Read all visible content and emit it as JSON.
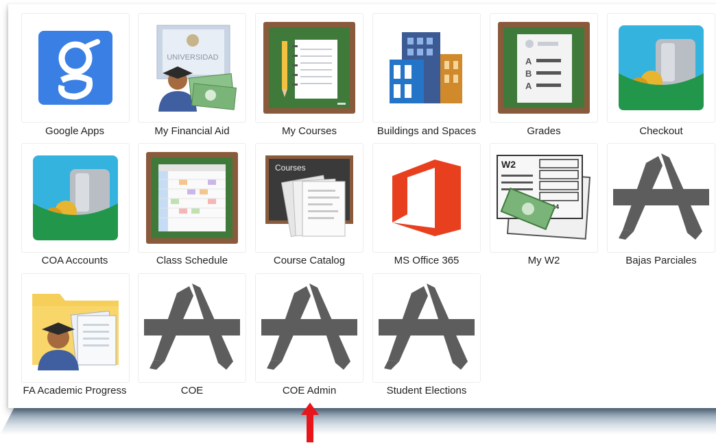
{
  "apps": [
    {
      "label": "Google Apps",
      "icon": "google-g-icon"
    },
    {
      "label": "My Financial Aid",
      "icon": "graduate-money-icon"
    },
    {
      "label": "My Courses",
      "icon": "notebook-chalkboard-icon"
    },
    {
      "label": "Buildings and Spaces",
      "icon": "buildings-icon"
    },
    {
      "label": "Grades",
      "icon": "grades-sheet-icon"
    },
    {
      "label": "Checkout",
      "icon": "wallet-coins-icon"
    },
    {
      "label": "COA Accounts",
      "icon": "wallet-coins-icon"
    },
    {
      "label": "Class Schedule",
      "icon": "schedule-grid-icon"
    },
    {
      "label": "Course Catalog",
      "icon": "course-catalog-icon"
    },
    {
      "label": "MS Office 365",
      "icon": "office-icon"
    },
    {
      "label": "My W2",
      "icon": "w2-form-icon"
    },
    {
      "label": "Bajas Parciales",
      "icon": "app-store-icon"
    },
    {
      "label": "FA Academic Progress",
      "icon": "folder-graduate-icon"
    },
    {
      "label": "COE",
      "icon": "app-store-icon"
    },
    {
      "label": "COE Admin",
      "icon": "app-store-icon"
    },
    {
      "label": "Student Elections",
      "icon": "app-store-icon"
    }
  ],
  "icon_text": {
    "universidad": "UNIVERSIDAD",
    "courses": "Courses",
    "w2": "W2",
    "year": "2014",
    "grade_a": "A",
    "grade_b": "B",
    "grade_a2": "A"
  },
  "colors": {
    "google_blue": "#3a7fe4",
    "chalk_green": "#3f7a3a",
    "wood": "#8a5a3c",
    "office_red": "#e8401f",
    "app_gray": "#5d5d5d",
    "arrow_red": "#e8151b"
  }
}
